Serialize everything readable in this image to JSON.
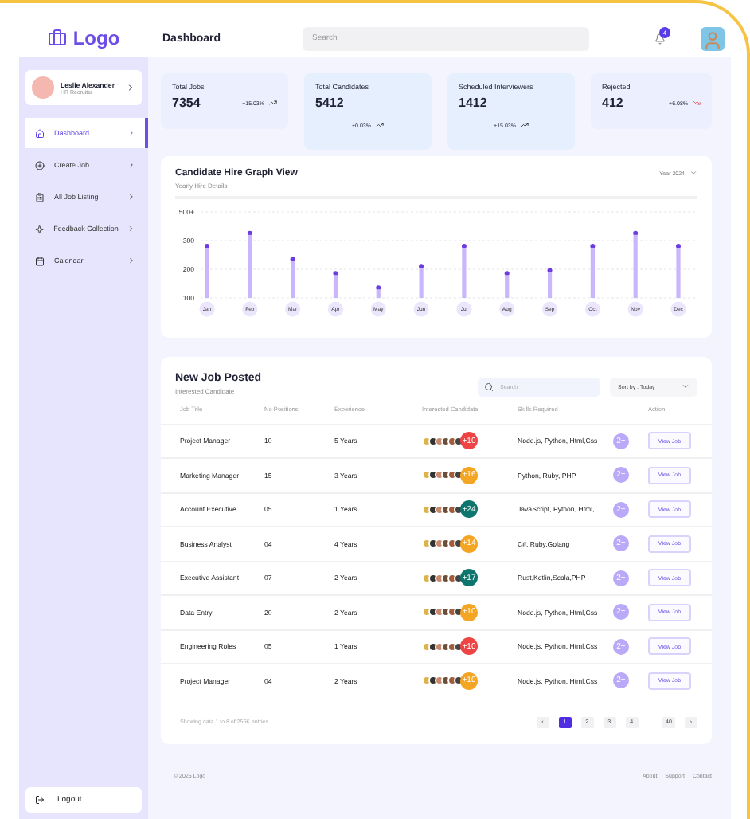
{
  "logo": {
    "text": "Logo"
  },
  "header": {
    "title": "Dashboard",
    "search_placeholder": "Search",
    "notification_count": "4"
  },
  "profile": {
    "name": "Leslie Alexander",
    "role": "HR Recruiter"
  },
  "sidebar": {
    "items": [
      {
        "label": "Dashboard",
        "selected": true
      },
      {
        "label": "Create Job",
        "selected": false
      },
      {
        "label": "All Job Listing",
        "selected": false
      },
      {
        "label": "Feedback Collection",
        "selected": false
      },
      {
        "label": "Calendar",
        "selected": false
      }
    ],
    "logout": "Logout"
  },
  "stats": [
    {
      "label": "Total Jobs",
      "value": "7354",
      "change": "+15.03%",
      "kind": "up",
      "tall": false
    },
    {
      "label": "Total Candidates",
      "value": "5412",
      "change": "+0.03%",
      "kind": "up",
      "tall": true
    },
    {
      "label": "Scheduled Interviewers",
      "value": "1412",
      "change": "+15.03%",
      "kind": "up",
      "tall": true
    },
    {
      "label": "Rejected",
      "value": "412",
      "change": "+6.08%",
      "kind": "down",
      "tall": false
    }
  ],
  "hire_graph": {
    "title": "Candidate Hire Graph View",
    "subtitle": "Yearly Hire Details",
    "year_select": "Year 2024",
    "chart_data": {
      "type": "bar",
      "categories": [
        "Jan",
        "Feb",
        "Mar",
        "Apr",
        "May",
        "Jun",
        "Jul",
        "Aug",
        "Sep",
        "Oct",
        "Nov",
        "Dec"
      ],
      "values": [
        275,
        320,
        230,
        180,
        130,
        205,
        275,
        180,
        190,
        275,
        320,
        275
      ],
      "ylim": [
        100,
        400
      ],
      "yticks": [
        100,
        200,
        300,
        {
          "value": 400,
          "label": "500+"
        }
      ]
    }
  },
  "jobs": {
    "title": "New Job Posted",
    "subtitle": "Interested Candidate",
    "search_placeholder": "Search",
    "sort": "Sort by : Today",
    "columns": [
      "Job Title",
      "No Positions",
      "Experience",
      "Interested Candidate",
      "Skills Required",
      "Action"
    ],
    "rows": [
      {
        "title": "Project Manager",
        "positions": "10",
        "experience": "5 Years",
        "extra": "+10",
        "color": "#ef4444",
        "skills": "Node.js, Python, Html,Css",
        "more": "2+",
        "action": "View Job"
      },
      {
        "title": "Marketing Manager",
        "positions": "15",
        "experience": "3 Years",
        "extra": "+16",
        "color": "#f5a524",
        "skills": "Python, Ruby, PHP,",
        "more": "2+",
        "action": "View Job"
      },
      {
        "title": "Account Executive",
        "positions": "05",
        "experience": "1 Years",
        "extra": "+24",
        "color": "#0f766e",
        "skills": "JavaScript, Python, Html,",
        "more": "2+",
        "action": "View Job"
      },
      {
        "title": "Business Analyst",
        "positions": "04",
        "experience": "4 Years",
        "extra": "+14",
        "color": "#f5a524",
        "skills": "C#, Ruby,Golang",
        "more": "2+",
        "action": "View Job"
      },
      {
        "title": "Executive Assistant",
        "positions": "07",
        "experience": "2 Years",
        "extra": "+17",
        "color": "#0f766e",
        "skills": "Rust,Kotlin,Scala,PHP",
        "more": "2+",
        "action": "View Job"
      },
      {
        "title": "Data Entry",
        "positions": "20",
        "experience": "2 Years",
        "extra": "+10",
        "color": "#f5a524",
        "skills": "Node.js, Python, Html,Css",
        "more": "2+",
        "action": "View Job"
      },
      {
        "title": "Engineering Roles",
        "positions": "05",
        "experience": "1 Years",
        "extra": "+10",
        "color": "#ef4444",
        "skills": "Node.js, Python, Html,Css",
        "more": "2+",
        "action": "View Job"
      },
      {
        "title": "Project Manager",
        "positions": "04",
        "experience": "2 Years",
        "extra": "+10",
        "color": "#f5a524",
        "skills": "Node.js, Python, Html,Css",
        "more": "2+",
        "action": "View Job"
      }
    ],
    "footer_text": "Showing data 1 to 8 of  256K entries",
    "pagination": [
      {
        "label": "‹",
        "selected": false
      },
      {
        "label": "1",
        "selected": true
      },
      {
        "label": "2",
        "selected": false
      },
      {
        "label": "3",
        "selected": false
      },
      {
        "label": "4",
        "selected": false
      },
      {
        "label": "...",
        "selected": false
      },
      {
        "label": "40",
        "selected": false
      },
      {
        "label": "›",
        "selected": false
      }
    ]
  },
  "footer": {
    "copyright": "© 2025 Logo",
    "links": [
      "About",
      "Support",
      "Contact"
    ]
  }
}
